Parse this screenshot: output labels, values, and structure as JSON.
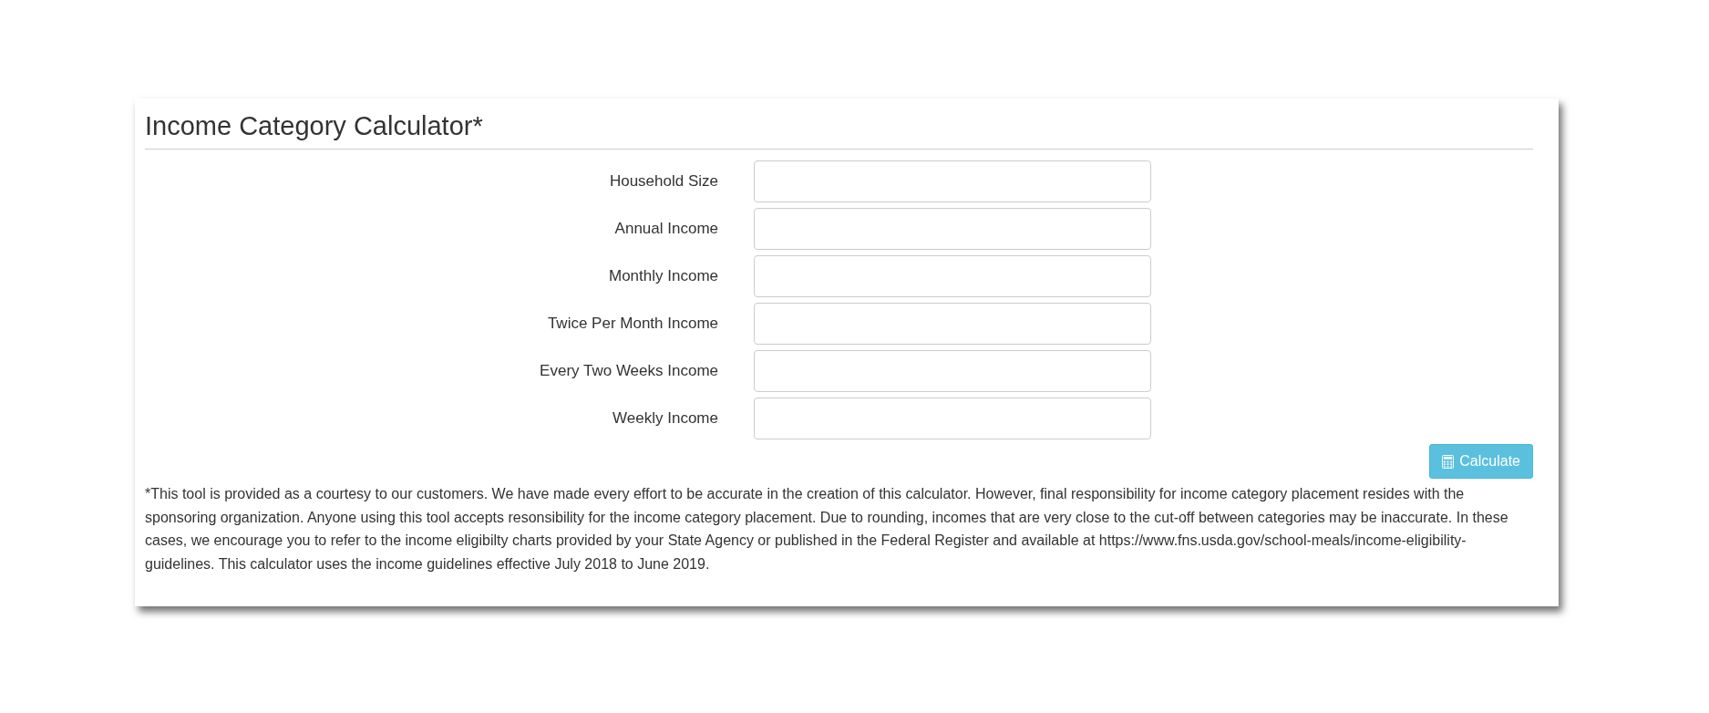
{
  "title": "Income Category Calculator*",
  "fields": [
    {
      "label": "Household Size"
    },
    {
      "label": "Annual Income"
    },
    {
      "label": "Monthly Income"
    },
    {
      "label": "Twice Per Month Income"
    },
    {
      "label": "Every Two Weeks Income"
    },
    {
      "label": "Weekly Income"
    }
  ],
  "button": {
    "label": "Calculate"
  },
  "footnote": "*This tool is provided as a courtesy to our customers. We have made every effort to be accurate in the creation of this calculator. However, final responsibility for income category placement resides with the sponsoring organization. Anyone using this tool accepts resonsibility for the income category placement. Due to rounding, incomes that are very close to the cut-off between categories may be inaccurate. In these cases, we encourage you to refer to the income eligibilty charts provided by your State Agency or published in the Federal Register and available at https://www.fns.usda.gov/school-meals/income-eligibility-guidelines. This calculator uses the income guidelines effective July 2018 to June 2019."
}
